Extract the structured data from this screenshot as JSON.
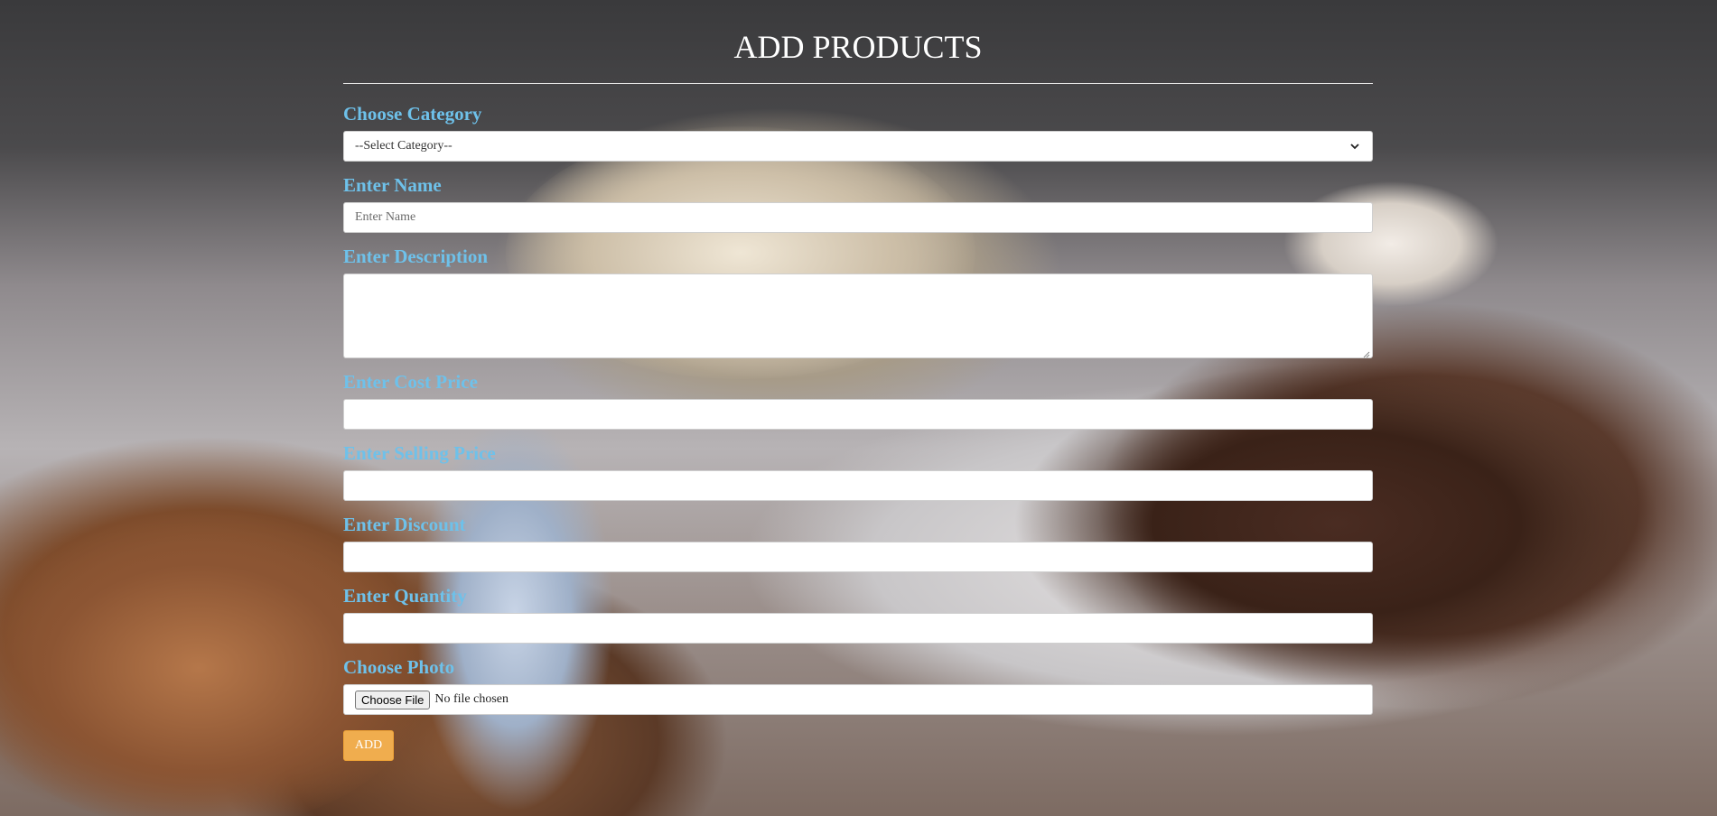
{
  "page": {
    "title": "ADD PRODUCTS"
  },
  "form": {
    "category": {
      "label": "Choose Category",
      "selected": "--Select Category--"
    },
    "name": {
      "label": "Enter Name",
      "placeholder": "Enter Name",
      "value": ""
    },
    "description": {
      "label": "Enter Description",
      "value": ""
    },
    "cost_price": {
      "label": "Enter Cost Price",
      "value": ""
    },
    "selling_price": {
      "label": "Enter Selling Price",
      "value": ""
    },
    "discount": {
      "label": "Enter Discount",
      "value": ""
    },
    "quantity": {
      "label": "Enter Quantity",
      "value": ""
    },
    "photo": {
      "label": "Choose Photo",
      "button_label": "Choose File",
      "status": "No file chosen"
    },
    "submit_label": "ADD"
  },
  "colors": {
    "label": "#6ec1ea",
    "title": "#ffffff",
    "add_button": "#f0ad4e"
  },
  "icons": {
    "select_chevron": "chevron-down-icon",
    "textarea_resize": "resize-handle-icon"
  }
}
